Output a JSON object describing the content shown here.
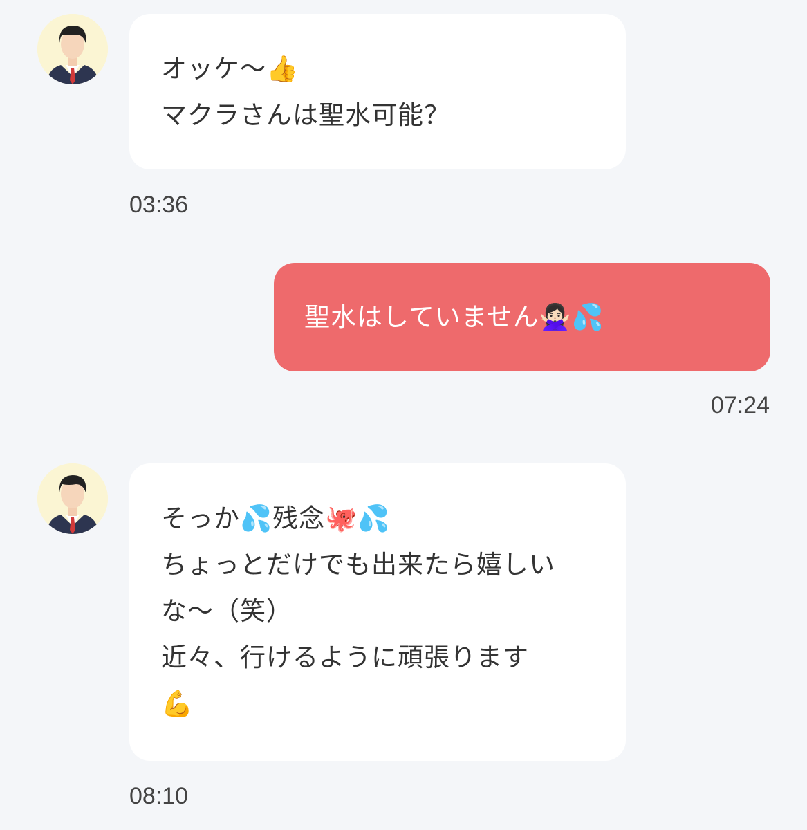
{
  "messages": [
    {
      "sender": "partner",
      "lines": [
        "オッケ〜👍",
        "マクラさんは聖水可能？"
      ],
      "time": "03:36"
    },
    {
      "sender": "me",
      "lines": [
        "聖水はしていません🙅🏻‍♀️💦"
      ],
      "time": "07:24"
    },
    {
      "sender": "partner",
      "lines": [
        "そっか💦残念🐙💦",
        "ちょっとだけでも出来たら嬉しい",
        "な〜（笑）",
        "近々、行けるように頑張ります",
        "💪"
      ],
      "time": "08:10"
    }
  ],
  "colors": {
    "background": "#f4f6f9",
    "incoming_bubble": "#ffffff",
    "outgoing_bubble": "#ee6a6c",
    "avatar_bg": "#fbf5d3"
  },
  "icons": {
    "avatar": "businessman-avatar-icon"
  }
}
